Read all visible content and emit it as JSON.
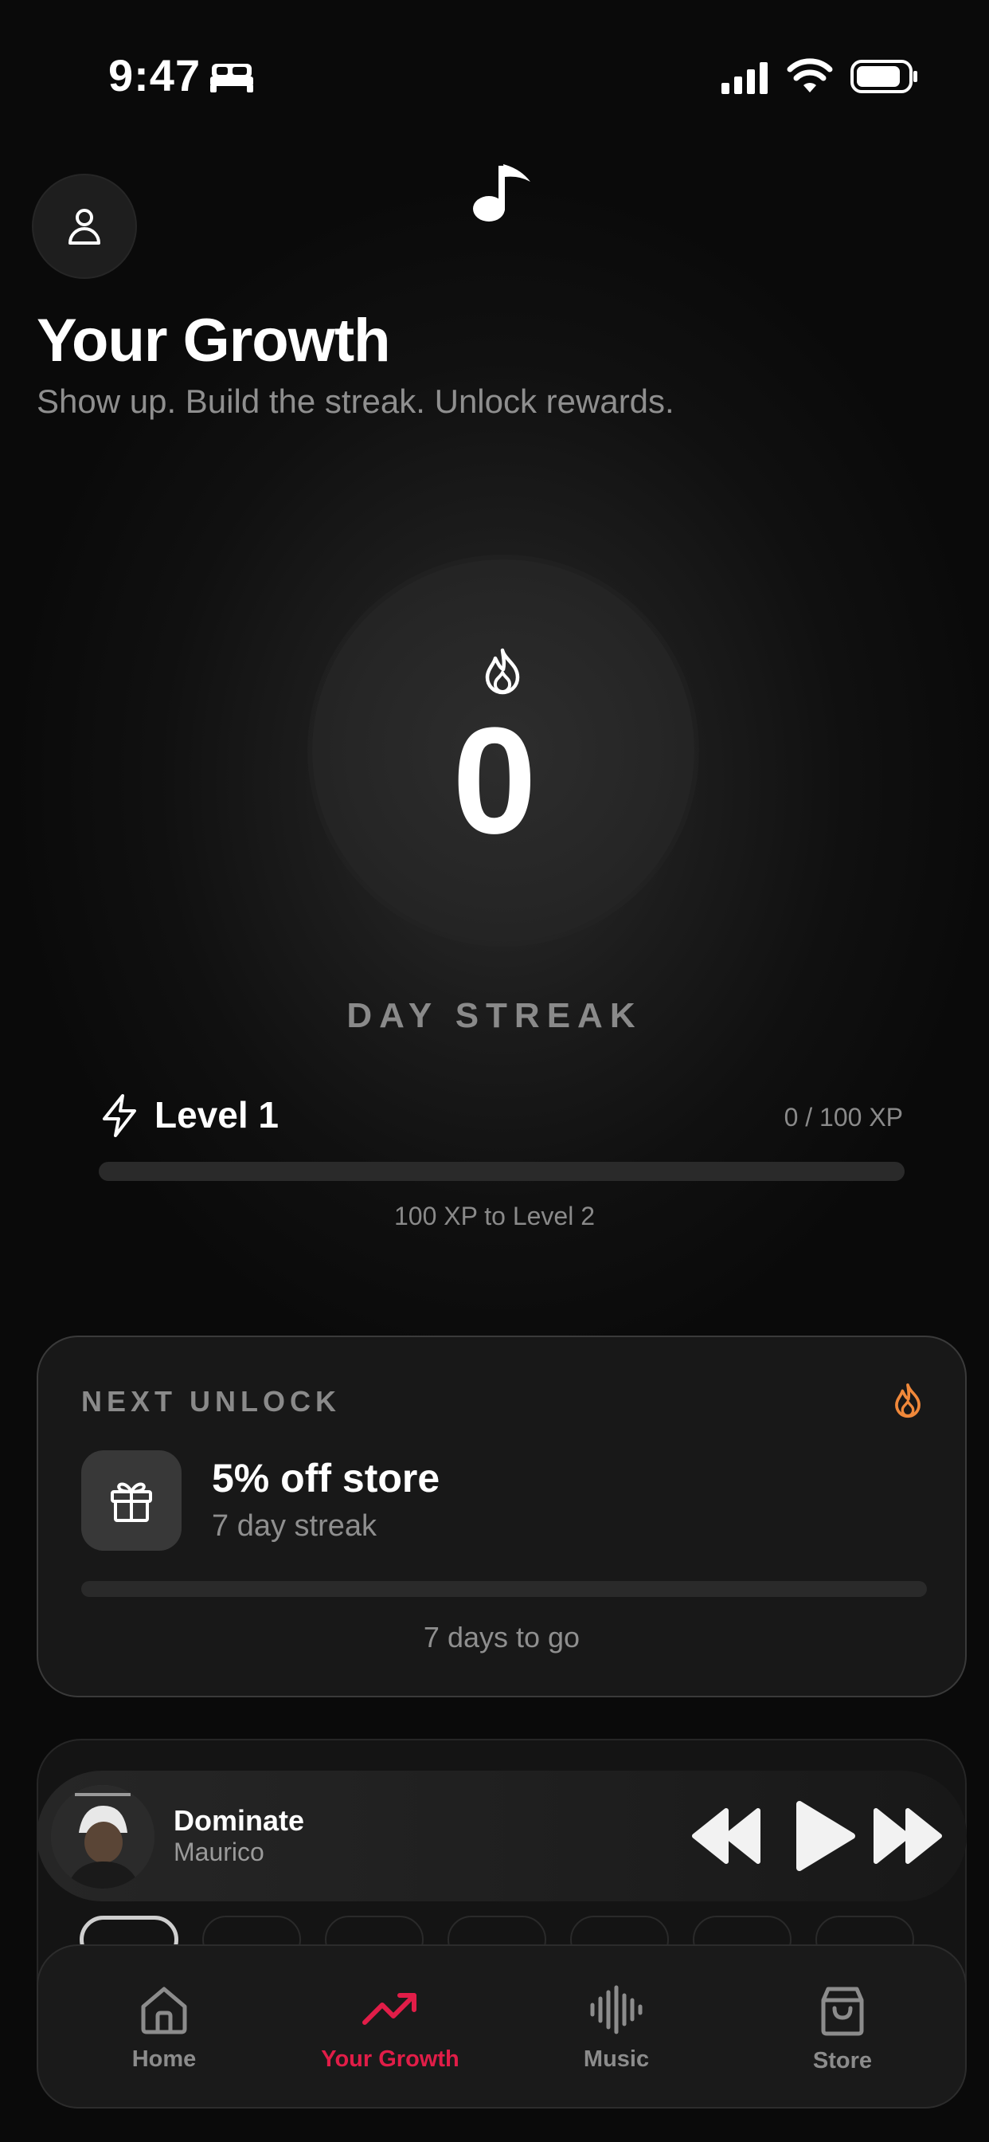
{
  "status_bar": {
    "time": "9:47"
  },
  "header": {
    "title": "Your Growth",
    "subtitle": "Show up. Build the streak. Unlock rewards."
  },
  "streak": {
    "count": "0",
    "label": "DAY STREAK"
  },
  "level": {
    "label": "Level 1",
    "xp_readout": "0 / 100 XP",
    "progress": 0,
    "hint": "100 XP to Level 2"
  },
  "next_unlock": {
    "heading": "NEXT UNLOCK",
    "reward_title": "5% off store",
    "reward_requirement": "7 day streak",
    "progress": 0,
    "hint": "7 days to go"
  },
  "player": {
    "track_title": "Dominate",
    "artist": "Maurico"
  },
  "tabs": [
    {
      "label": "Home",
      "icon": "home-icon",
      "active": false
    },
    {
      "label": "Your Growth",
      "icon": "trending-up-icon",
      "active": true
    },
    {
      "label": "Music",
      "icon": "waveform-icon",
      "active": false
    },
    {
      "label": "Store",
      "icon": "shopping-bag-icon",
      "active": false
    }
  ],
  "colors": {
    "accent": "#e11d48",
    "flame": "#f0883a",
    "background": "#0a0a0a"
  }
}
